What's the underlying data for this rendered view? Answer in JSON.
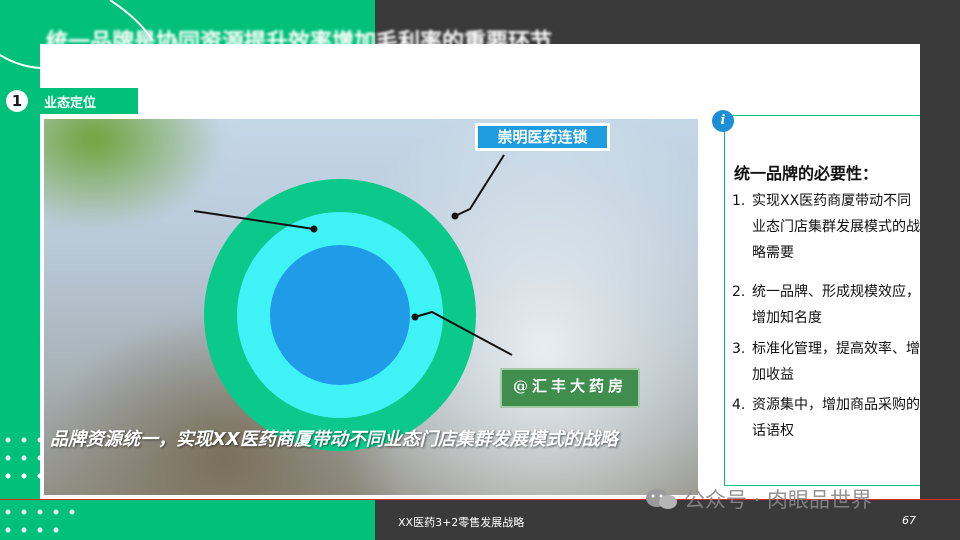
{
  "slide": {
    "title": "统一品牌是协同资源提升效率增加毛利率的重要环节",
    "page_number": "67",
    "footer_text": "XX医药3+2零售发展战略",
    "colors": {
      "accent_green": "#00c07a",
      "dark_bar": "#3a3a3a",
      "blue_tag": "#1f9be0",
      "circle_outer": "#0bc98a",
      "circle_middle": "#3ef2f6",
      "circle_inner": "#1f9be8"
    }
  },
  "section": {
    "number": "1",
    "label": "业态定位"
  },
  "diagram": {
    "brand_tag": "崇明医药连锁",
    "store_sign": "@汇丰大药房",
    "caption": "品牌资源统一，实现XX医药商厦带动不同业态门店集群发展模式的战略"
  },
  "info": {
    "icon": "info-icon",
    "title": "统一品牌的必要性：",
    "items": [
      {
        "num": "1.",
        "text": "实现XX医药商厦带动不同业态门店集群发展模式的战略需要"
      },
      {
        "num": "2.",
        "text": "统一品牌、形成规模效应，增加知名度"
      },
      {
        "num": "3.",
        "text": "标准化管理，提高效率、增加收益"
      },
      {
        "num": "4.",
        "text": "资源集中，增加商品采购的话语权"
      }
    ]
  },
  "watermark": {
    "text": "公众号 · 肉眼品世界",
    "icon": "wechat-icon"
  }
}
